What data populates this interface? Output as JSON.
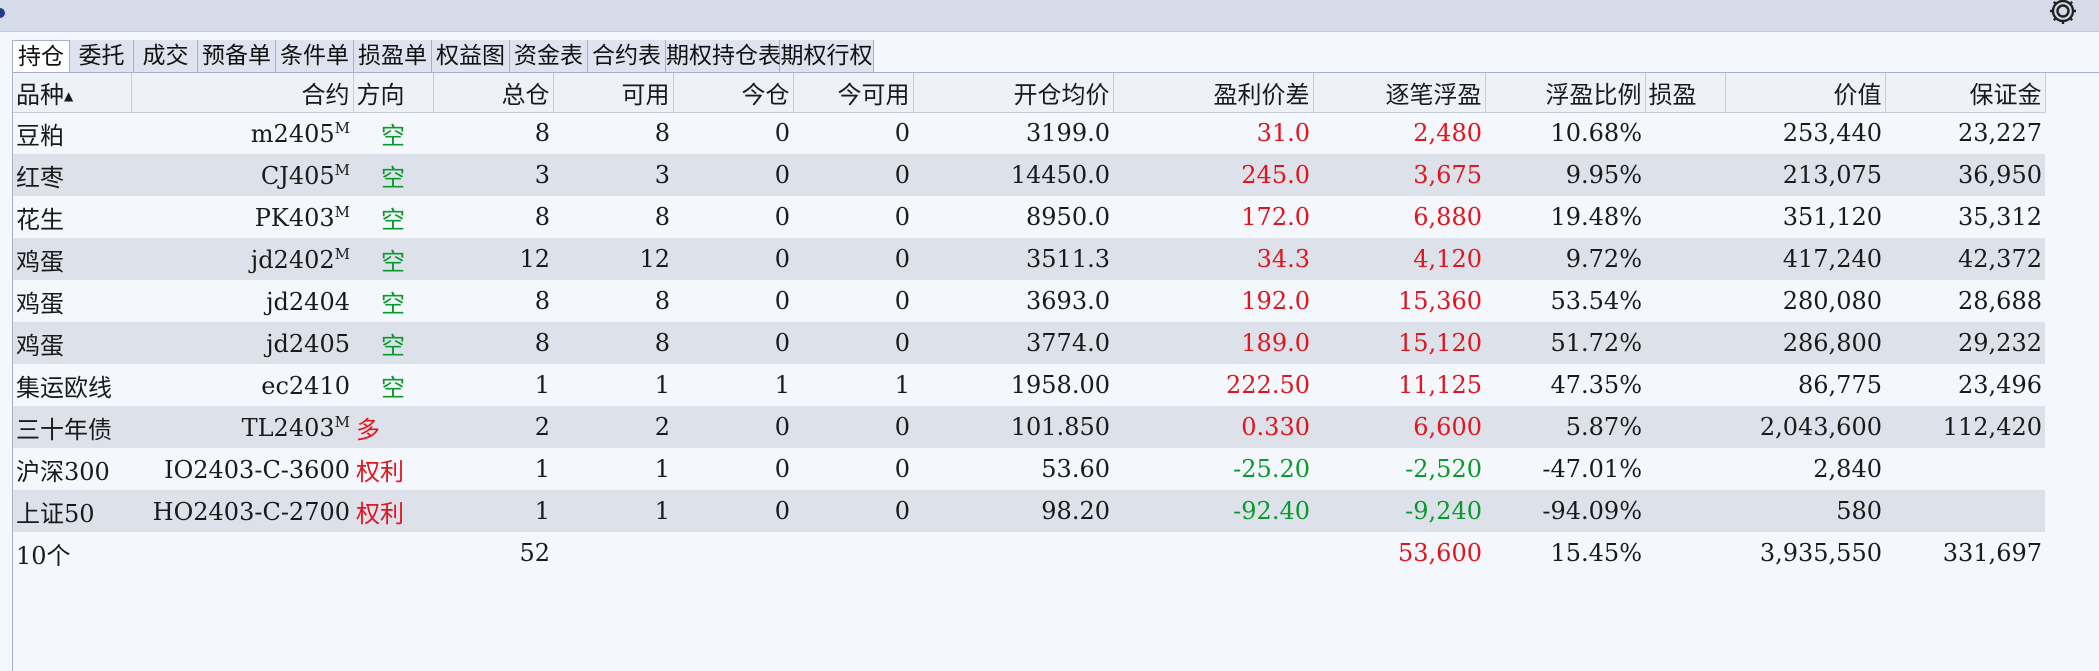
{
  "colors": {
    "profit": "#e0151d",
    "loss": "#0a9a2c",
    "short": "#0a9a2c",
    "long": "#e0151d"
  },
  "icons": {
    "settings": "gear-icon",
    "sort": "sort-up-icon"
  },
  "tabs": [
    {
      "label": "持仓",
      "active": true
    },
    {
      "label": "委托"
    },
    {
      "label": "成交"
    },
    {
      "label": "预备单"
    },
    {
      "label": "条件单"
    },
    {
      "label": "损盈单"
    },
    {
      "label": "权益图"
    },
    {
      "label": "资金表"
    },
    {
      "label": "合约表"
    },
    {
      "label": "期权持仓表"
    },
    {
      "label": "期权行权"
    }
  ],
  "table": {
    "sort_marker": "▲",
    "columns": [
      {
        "key": "variety",
        "label": "品种",
        "align": "l"
      },
      {
        "key": "contract",
        "label": "合约",
        "align": "r"
      },
      {
        "key": "direction",
        "label": "方向",
        "align": "l"
      },
      {
        "key": "total",
        "label": "总仓",
        "align": "r"
      },
      {
        "key": "available",
        "label": "可用",
        "align": "r"
      },
      {
        "key": "today",
        "label": "今仓",
        "align": "r"
      },
      {
        "key": "today_avail",
        "label": "今可用",
        "align": "r"
      },
      {
        "key": "avg_price",
        "label": "开仓均价",
        "align": "r"
      },
      {
        "key": "diff",
        "label": "盈利价差",
        "align": "r"
      },
      {
        "key": "float_pnl",
        "label": "逐笔浮盈",
        "align": "r"
      },
      {
        "key": "float_ratio",
        "label": "浮盈比例",
        "align": "r"
      },
      {
        "key": "sl",
        "label": "损盈",
        "align": "l"
      },
      {
        "key": "value",
        "label": "价值",
        "align": "r"
      },
      {
        "key": "margin",
        "label": "保证金",
        "align": "r"
      }
    ],
    "rows": [
      {
        "variety": "豆粕",
        "contract": "m2405",
        "mark": "M",
        "direction": "空",
        "dir": "short",
        "total": "8",
        "available": "8",
        "today": "0",
        "today_avail": "0",
        "avg_price": "3199.0",
        "diff": "31.0",
        "float_pnl": "2,480",
        "pnl_sign": "pos",
        "float_ratio": "10.68%",
        "sl": "",
        "value": "253,440",
        "margin": "23,227"
      },
      {
        "variety": "红枣",
        "contract": "CJ405",
        "mark": "M",
        "direction": "空",
        "dir": "short",
        "total": "3",
        "available": "3",
        "today": "0",
        "today_avail": "0",
        "avg_price": "14450.0",
        "diff": "245.0",
        "float_pnl": "3,675",
        "pnl_sign": "pos",
        "float_ratio": "9.95%",
        "sl": "",
        "value": "213,075",
        "margin": "36,950"
      },
      {
        "variety": "花生",
        "contract": "PK403",
        "mark": "M",
        "direction": "空",
        "dir": "short",
        "total": "8",
        "available": "8",
        "today": "0",
        "today_avail": "0",
        "avg_price": "8950.0",
        "diff": "172.0",
        "float_pnl": "6,880",
        "pnl_sign": "pos",
        "float_ratio": "19.48%",
        "sl": "",
        "value": "351,120",
        "margin": "35,312"
      },
      {
        "variety": "鸡蛋",
        "contract": "jd2402",
        "mark": "M",
        "direction": "空",
        "dir": "short",
        "total": "12",
        "available": "12",
        "today": "0",
        "today_avail": "0",
        "avg_price": "3511.3",
        "diff": "34.3",
        "float_pnl": "4,120",
        "pnl_sign": "pos",
        "float_ratio": "9.72%",
        "sl": "",
        "value": "417,240",
        "margin": "42,372"
      },
      {
        "variety": "鸡蛋",
        "contract": "jd2404",
        "mark": "",
        "direction": "空",
        "dir": "short",
        "total": "8",
        "available": "8",
        "today": "0",
        "today_avail": "0",
        "avg_price": "3693.0",
        "diff": "192.0",
        "float_pnl": "15,360",
        "pnl_sign": "pos",
        "float_ratio": "53.54%",
        "sl": "",
        "value": "280,080",
        "margin": "28,688"
      },
      {
        "variety": "鸡蛋",
        "contract": "jd2405",
        "mark": "",
        "direction": "空",
        "dir": "short",
        "total": "8",
        "available": "8",
        "today": "0",
        "today_avail": "0",
        "avg_price": "3774.0",
        "diff": "189.0",
        "float_pnl": "15,120",
        "pnl_sign": "pos",
        "float_ratio": "51.72%",
        "sl": "",
        "value": "286,800",
        "margin": "29,232"
      },
      {
        "variety": "集运欧线",
        "contract": "ec2410",
        "mark": "",
        "direction": "空",
        "dir": "short",
        "total": "1",
        "available": "1",
        "today": "1",
        "today_avail": "1",
        "avg_price": "1958.00",
        "diff": "222.50",
        "float_pnl": "11,125",
        "pnl_sign": "pos",
        "float_ratio": "47.35%",
        "sl": "",
        "value": "86,775",
        "margin": "23,496"
      },
      {
        "variety": "三十年债",
        "contract": "TL2403",
        "mark": "M",
        "direction": "多",
        "dir": "long",
        "total": "2",
        "available": "2",
        "today": "0",
        "today_avail": "0",
        "avg_price": "101.850",
        "diff": "0.330",
        "float_pnl": "6,600",
        "pnl_sign": "pos",
        "float_ratio": "5.87%",
        "sl": "",
        "value": "2,043,600",
        "margin": "112,420"
      },
      {
        "variety": "沪深300",
        "contract": "IO2403-C-3600",
        "mark": "",
        "direction": "权利",
        "dir": "long",
        "total": "1",
        "available": "1",
        "today": "0",
        "today_avail": "0",
        "avg_price": "53.60",
        "diff": "-25.20",
        "float_pnl": "-2,520",
        "pnl_sign": "neg",
        "float_ratio": "-47.01%",
        "sl": "",
        "value": "2,840",
        "margin": ""
      },
      {
        "variety": "上证50",
        "contract": "HO2403-C-2700",
        "mark": "",
        "direction": "权利",
        "dir": "long",
        "total": "1",
        "available": "1",
        "today": "0",
        "today_avail": "0",
        "avg_price": "98.20",
        "diff": "-92.40",
        "float_pnl": "-9,240",
        "pnl_sign": "neg",
        "float_ratio": "-94.09%",
        "sl": "",
        "value": "580",
        "margin": ""
      }
    ],
    "total": {
      "variety": "10个",
      "total": "52",
      "float_pnl": "53,600",
      "float_ratio": "15.45%",
      "value": "3,935,550",
      "margin": "331,697"
    }
  }
}
